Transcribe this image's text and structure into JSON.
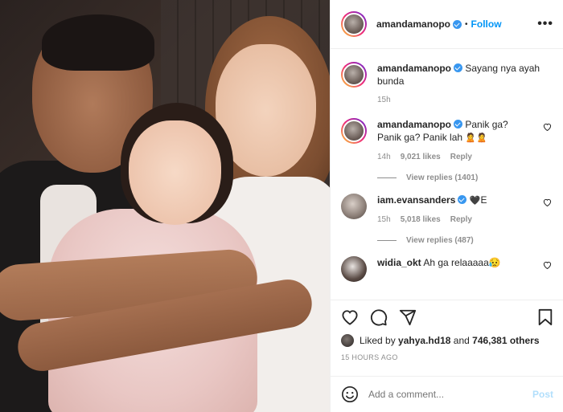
{
  "post": {
    "author": "amandamanopo",
    "follow_label": "Follow",
    "dot": "•",
    "more_label": "•••"
  },
  "comments": [
    {
      "username": "amandamanopo",
      "verified": true,
      "text": "Sayang nya ayah bunda",
      "time": "15h"
    },
    {
      "username": "amandamanopo",
      "verified": true,
      "text": "Panik ga? Panik ga? Panik lah",
      "emoji": "🙎🙎",
      "time": "14h",
      "likes": "9,021 likes",
      "reply_label": "Reply",
      "view_replies": "View replies (1401)"
    },
    {
      "username": "iam.evansanders",
      "verified": true,
      "text": "E",
      "emoji": "🖤",
      "time": "15h",
      "likes": "5,018 likes",
      "reply_label": "Reply",
      "view_replies": "View replies (487)"
    },
    {
      "username": "widia_okt",
      "verified": false,
      "text": "Ah ga relaaaaa",
      "emoji": "😥"
    }
  ],
  "actions": {
    "liked_prefix": "Liked by",
    "liked_user": "yahya.hd18",
    "liked_and": "and",
    "liked_count": "746,381 others",
    "timestamp": "15 HOURS AGO"
  },
  "composer": {
    "placeholder": "Add a comment...",
    "post_label": "Post"
  },
  "icons": [
    "heart-icon",
    "comment-icon",
    "share-icon",
    "bookmark-icon",
    "smile-emoji-icon",
    "verified-badge-icon",
    "more-options-icon"
  ]
}
